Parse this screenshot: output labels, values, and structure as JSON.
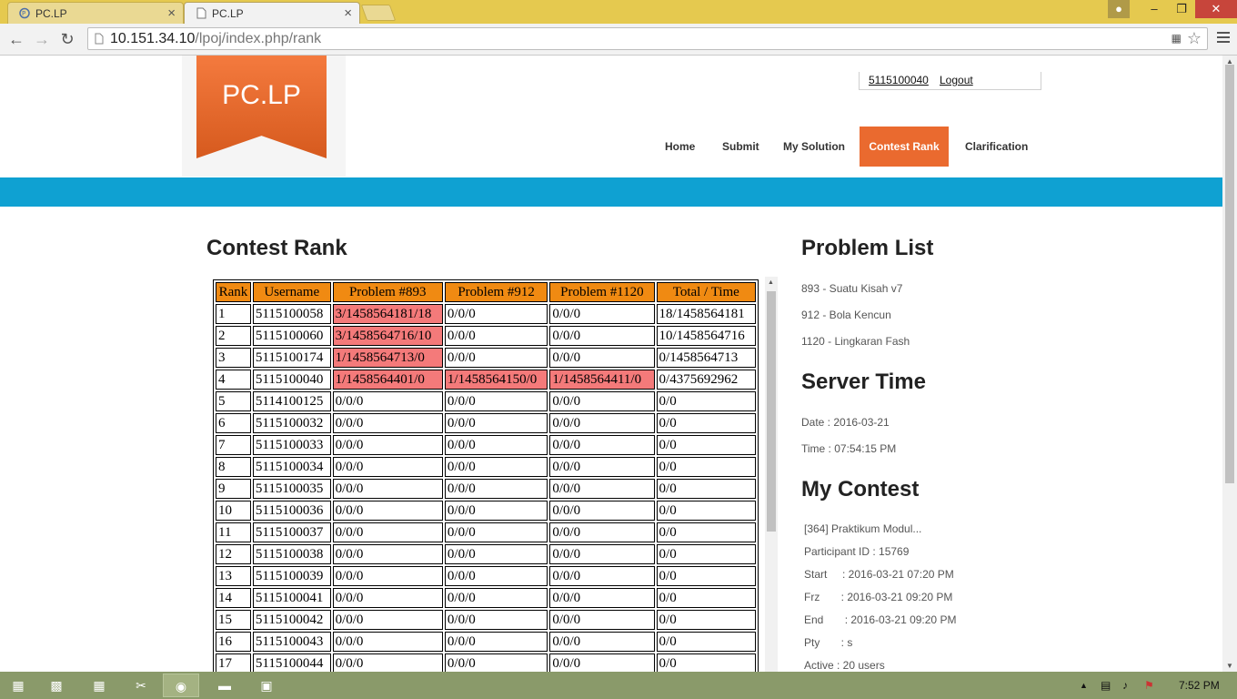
{
  "browser": {
    "tabs": [
      {
        "title": "PC.LP",
        "active": false
      },
      {
        "title": "PC.LP",
        "active": true
      }
    ],
    "url_host": "10.151.34.10",
    "url_path": "/lpoj/index.php/rank",
    "close_glyph": "×"
  },
  "site": {
    "logo_text": "PC.LP",
    "user": {
      "username": "5115100040",
      "logout_label": "Logout"
    },
    "nav": [
      {
        "label": "Home"
      },
      {
        "label": "Submit"
      },
      {
        "label": "My Solution"
      },
      {
        "label": "Contest Rank",
        "active": true
      },
      {
        "label": "Clarification"
      }
    ],
    "colors": {
      "accent": "#ea6a2f",
      "banner": "#0fa1d2",
      "table_header": "#f08a12",
      "solved_cell": "#f47a7a"
    }
  },
  "rank": {
    "title": "Contest Rank",
    "columns": [
      "Rank",
      "Username",
      "Problem #893",
      "Problem #912",
      "Problem #1120",
      "Total / Time"
    ],
    "rows": [
      [
        "1",
        "5115100058",
        "3/1458564181/18",
        "0/0/0",
        "0/0/0",
        "18/1458564181"
      ],
      [
        "2",
        "5115100060",
        "3/1458564716/10",
        "0/0/0",
        "0/0/0",
        "10/1458564716"
      ],
      [
        "3",
        "5115100174",
        "1/1458564713/0",
        "0/0/0",
        "0/0/0",
        "0/1458564713"
      ],
      [
        "4",
        "5115100040",
        "1/1458564401/0",
        "1/1458564150/0",
        "1/1458564411/0",
        "0/4375692962"
      ],
      [
        "5",
        "5114100125",
        "0/0/0",
        "0/0/0",
        "0/0/0",
        "0/0"
      ],
      [
        "6",
        "5115100032",
        "0/0/0",
        "0/0/0",
        "0/0/0",
        "0/0"
      ],
      [
        "7",
        "5115100033",
        "0/0/0",
        "0/0/0",
        "0/0/0",
        "0/0"
      ],
      [
        "8",
        "5115100034",
        "0/0/0",
        "0/0/0",
        "0/0/0",
        "0/0"
      ],
      [
        "9",
        "5115100035",
        "0/0/0",
        "0/0/0",
        "0/0/0",
        "0/0"
      ],
      [
        "10",
        "5115100036",
        "0/0/0",
        "0/0/0",
        "0/0/0",
        "0/0"
      ],
      [
        "11",
        "5115100037",
        "0/0/0",
        "0/0/0",
        "0/0/0",
        "0/0"
      ],
      [
        "12",
        "5115100038",
        "0/0/0",
        "0/0/0",
        "0/0/0",
        "0/0"
      ],
      [
        "13",
        "5115100039",
        "0/0/0",
        "0/0/0",
        "0/0/0",
        "0/0"
      ],
      [
        "14",
        "5115100041",
        "0/0/0",
        "0/0/0",
        "0/0/0",
        "0/0"
      ],
      [
        "15",
        "5115100042",
        "0/0/0",
        "0/0/0",
        "0/0/0",
        "0/0"
      ],
      [
        "16",
        "5115100043",
        "0/0/0",
        "0/0/0",
        "0/0/0",
        "0/0"
      ],
      [
        "17",
        "5115100044",
        "0/0/0",
        "0/0/0",
        "0/0/0",
        "0/0"
      ]
    ],
    "highlight": [
      [
        false,
        false,
        true,
        false,
        false,
        false
      ],
      [
        false,
        false,
        true,
        false,
        false,
        false
      ],
      [
        false,
        false,
        true,
        false,
        false,
        false
      ],
      [
        false,
        false,
        true,
        true,
        true,
        false
      ]
    ]
  },
  "sidebar": {
    "problem_list_title": "Problem List",
    "problems": [
      "893 - Suatu Kisah v7",
      "912 - Bola Kencun",
      "1120 - Lingkaran Fash"
    ],
    "server_time_title": "Server Time",
    "date_line": "Date : 2016-03-21",
    "time_line": "Time : 07:54:15 PM",
    "my_contest_title": "My Contest",
    "contest_lines": [
      "[364] Praktikum Modul...",
      "Participant ID : 15769",
      "Start     : 2016-03-21 07:20 PM",
      "Frz       : 2016-03-21 09:20 PM",
      "End       : 2016-03-21 09:20 PM",
      "Pty       : s",
      "Active : 20 users"
    ]
  },
  "taskbar": {
    "clock": "7:52 PM",
    "apps": [
      "start-icon",
      "cmd-icon",
      "calculator-icon",
      "snipping-tool-icon",
      "chrome-icon",
      "file-explorer-icon",
      "photos-icon"
    ]
  }
}
